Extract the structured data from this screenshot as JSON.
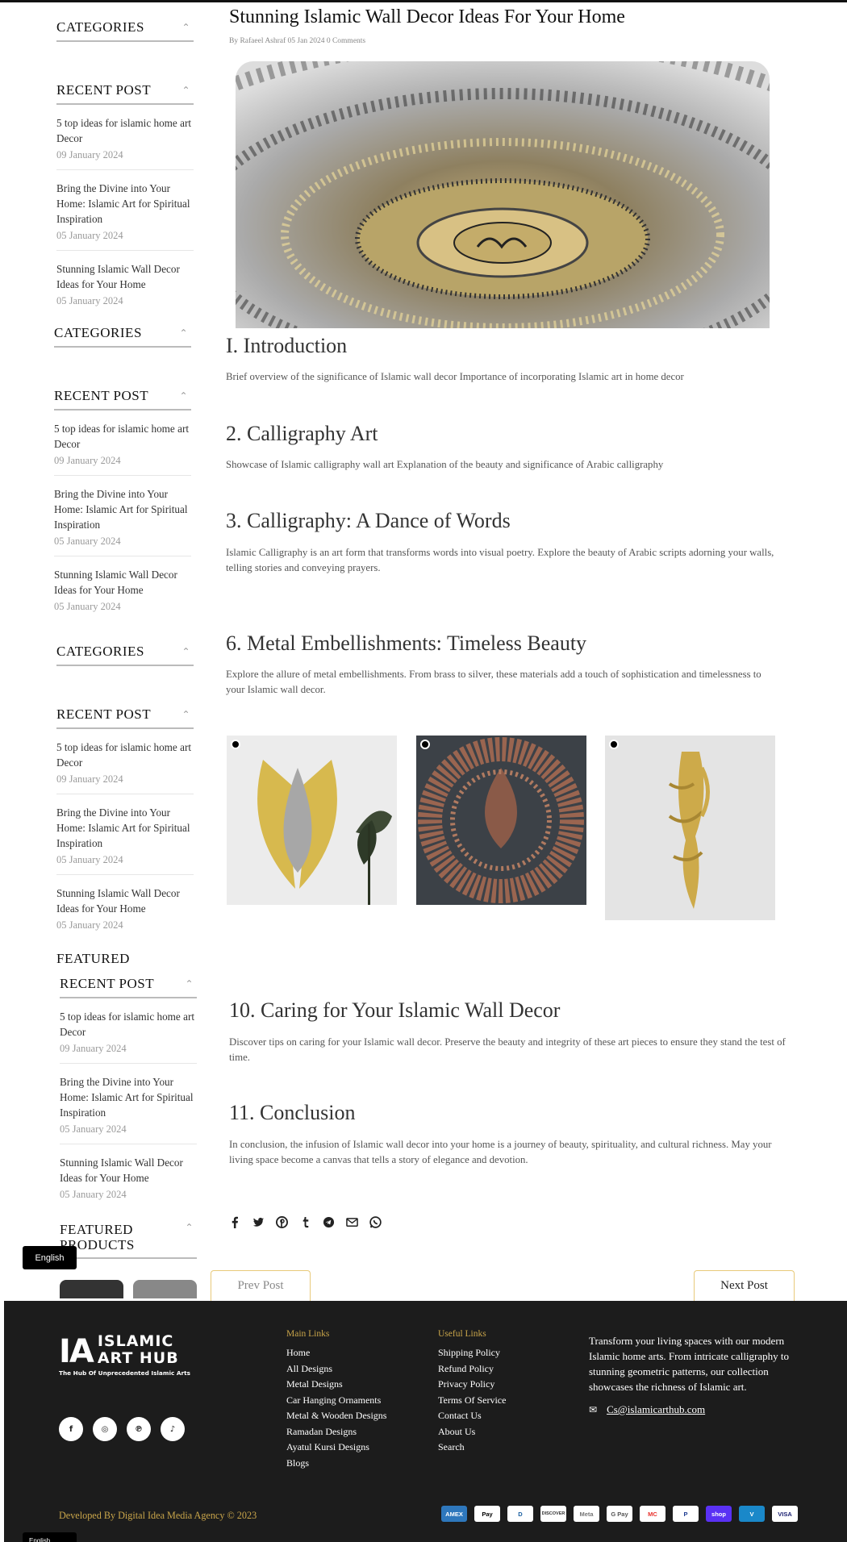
{
  "sidebar": {
    "categories_label": "CATEGORIES",
    "recent_label": "RECENT POST",
    "featured_label": "FEATURED PRODUCTS",
    "featured_cut": "FEATURED",
    "posts": [
      {
        "title": "5 top ideas for islamic home art Decor",
        "date": "09 January 2024"
      },
      {
        "title": "Bring the Divine into Your Home: Islamic Art for Spiritual Inspiration",
        "date": "05 January 2024"
      },
      {
        "title": "Stunning Islamic Wall Decor Ideas for Your Home",
        "date": "05 January 2024"
      }
    ]
  },
  "article": {
    "title": "Stunning Islamic Wall Decor Ideas For Your Home",
    "meta": "By Rafaeel Ashraf 05 Jan 2024 0 Comments",
    "sections": [
      {
        "heading": "I. Introduction",
        "text": "Brief overview of the significance of Islamic wall decor Importance of incorporating Islamic art in home decor"
      },
      {
        "heading": "2. Calligraphy Art",
        "text": "Showcase of Islamic calligraphy wall art Explanation of the beauty and significance of Arabic calligraphy"
      },
      {
        "heading": "3. Calligraphy: A Dance of Words",
        "text": "Islamic Calligraphy is an art form that transforms words into visual poetry. Explore the beauty of Arabic scripts adorning your walls, telling stories and conveying prayers."
      },
      {
        "heading": "6. Metal Embellishments: Timeless Beauty",
        "text": "Explore the allure of metal embellishments. From brass to silver, these materials add a touch of sophistication and timelessness to your Islamic wall decor."
      },
      {
        "heading": "10. Caring for Your Islamic Wall Decor",
        "text": "Discover tips on caring for your Islamic wall decor. Preserve the beauty and integrity of these art pieces to ensure they stand the test of time."
      },
      {
        "heading": "11. Conclusion",
        "text": "In conclusion, the infusion of Islamic wall decor into your home is a journey of beauty, spirituality, and cultural richness. May your living space become a canvas that tells a story of elegance and devotion."
      }
    ],
    "share_icons": [
      "facebook-icon",
      "twitter-icon",
      "pinterest-icon",
      "tumblr-icon",
      "telegram-icon",
      "email-icon",
      "whatsapp-icon"
    ],
    "prev_label": "Prev Post",
    "next_label": "Next Post"
  },
  "language": {
    "label": "English"
  },
  "footer": {
    "logo_line1": "ISLAMIC",
    "logo_line2": "ART HUB",
    "logo_mark": "IA",
    "tagline": "The Hub Of Unprecedented Islamic Arts",
    "main_links_title": "Main Links",
    "main_links": [
      "Home",
      "All Designs",
      "Metal Designs",
      "Car Hanging Ornaments",
      "Metal & Wooden Designs",
      "Ramadan Designs",
      "Ayatul Kursi Designs",
      "Blogs"
    ],
    "useful_links_title": "Useful Links",
    "useful_links": [
      "Shipping Policy",
      "Refund Policy",
      "Privacy Policy",
      "Terms Of Service",
      "Contact Us",
      "About Us",
      "Search"
    ],
    "about": "Transform your living spaces with our modern Islamic home arts. From intricate calligraphy to stunning geometric patterns, our collection showcases the richness of Islamic art.",
    "email": "Cs@islamicarthub.com",
    "developed_by": "Developed By Digital Idea Media Agency © 2023",
    "social": [
      "facebook-icon",
      "instagram-icon",
      "pinterest-icon",
      "tiktok-icon"
    ],
    "payments": [
      {
        "name": "AMEX",
        "color": "#2e77bc"
      },
      {
        "name": "Pay",
        "color": "#ffffff"
      },
      {
        "name": "D",
        "color": "#ffffff"
      },
      {
        "name": "DISCOVER",
        "color": "#ffffff"
      },
      {
        "name": "Meta",
        "color": "#ffffff"
      },
      {
        "name": "G Pay",
        "color": "#ffffff"
      },
      {
        "name": "MC",
        "color": "#ffffff"
      },
      {
        "name": "P",
        "color": "#ffffff"
      },
      {
        "name": "shop",
        "color": "#5a31f4"
      },
      {
        "name": "V",
        "color": "#1a88c9"
      },
      {
        "name": "VISA",
        "color": "#ffffff"
      }
    ]
  },
  "colors": {
    "gold": "#c9a54a",
    "footer_bg": "#1c1c1c"
  }
}
